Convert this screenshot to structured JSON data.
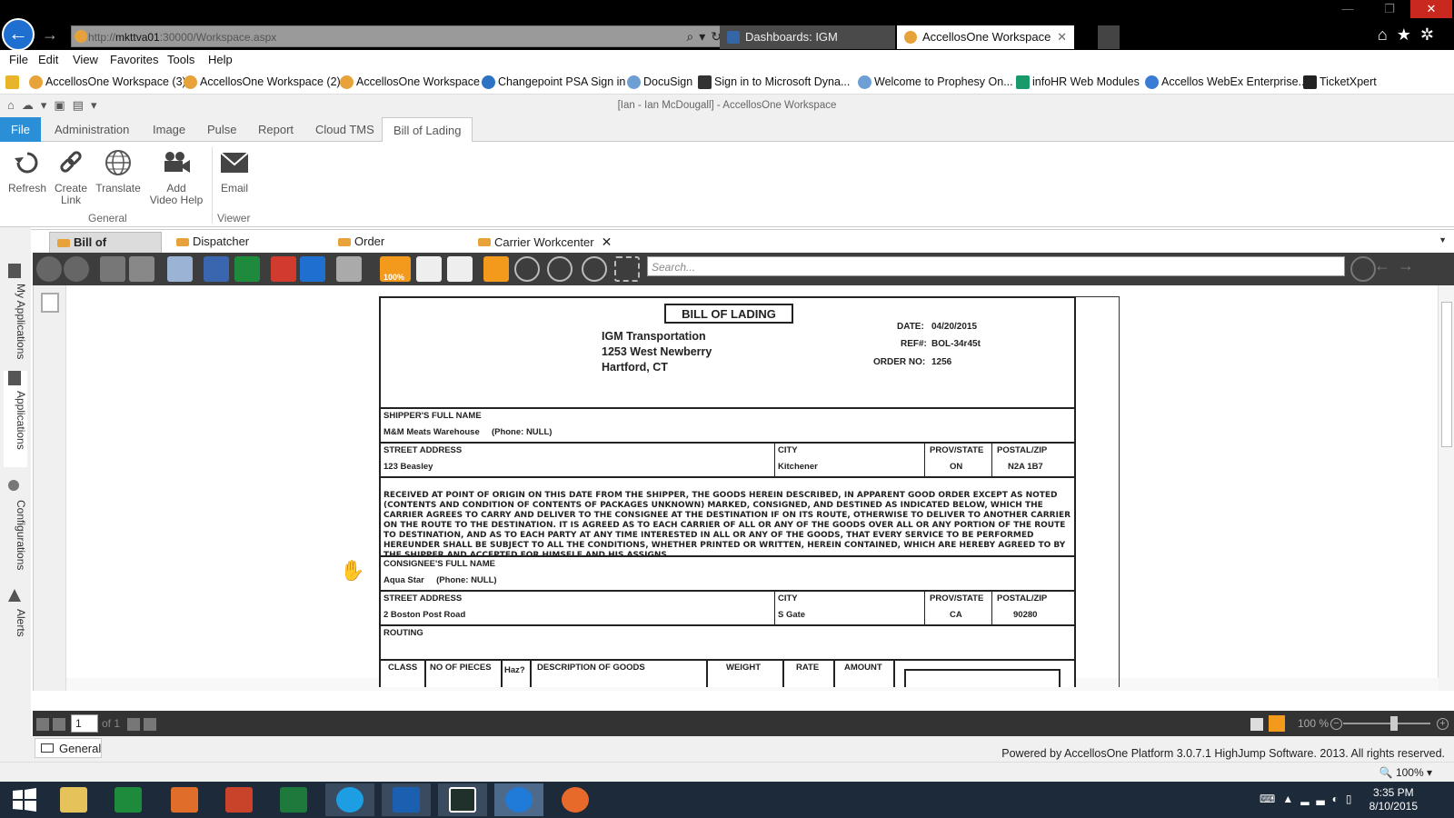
{
  "browser": {
    "url_prefix": "http://",
    "url_host": "mkttva01",
    "url_rest": ":30000/Workspace.aspx",
    "tabs": [
      {
        "label": "Dashboards: IGM Dashboard - ...",
        "active": false
      },
      {
        "label": "AccellosOne Workspace",
        "active": true,
        "close": "✕"
      }
    ],
    "menu": [
      "File",
      "Edit",
      "View",
      "Favorites",
      "Tools",
      "Help"
    ],
    "favorites": [
      "AccellosOne Workspace (3)",
      "AccellosOne Workspace (2)",
      "AccellosOne Workspace",
      "Changepoint PSA Sign in",
      "DocuSign",
      "Sign in to Microsoft Dyna...",
      "Welcome to Prophesy On...",
      "infoHR Web Modules",
      "Accellos WebEx Enterprise...",
      "TicketXpert"
    ],
    "window_title": "[Ian - Ian McDougall] - AccellosOne Workspace"
  },
  "ribbon": {
    "tabs": [
      "File",
      "Administration",
      "Image",
      "Pulse",
      "Report",
      "Cloud TMS",
      "Bill of Lading"
    ],
    "buttons": [
      {
        "label1": "Refresh",
        "label2": ""
      },
      {
        "label1": "Create",
        "label2": "Link"
      },
      {
        "label1": "Translate",
        "label2": ""
      },
      {
        "label1": "Add",
        "label2": "Video Help"
      },
      {
        "label1": "Email",
        "label2": ""
      }
    ],
    "groups": [
      "General",
      "Viewer"
    ]
  },
  "leftnav": [
    "My Applications",
    "Applications",
    "Configurations",
    "Alerts"
  ],
  "doc_tabs": [
    {
      "label": "Bill of Lading",
      "active": true
    },
    {
      "label": "Dispatcher Workcenter",
      "active": false
    },
    {
      "label": "Order Workcenter",
      "active": false
    },
    {
      "label": "Carrier Workcenter",
      "active": false
    }
  ],
  "viewer": {
    "search_placeholder": "Search...",
    "zoom_badge": "100%",
    "page_current": "1",
    "page_of": "of 1",
    "zoom_level": "100 %"
  },
  "bol": {
    "title": "BILL OF LADING",
    "company_name": "IGM Transportation",
    "company_addr1": "1253 West Newberry",
    "company_addr2": "Hartford, CT",
    "date_label": "DATE:",
    "date_value": "04/20/2015",
    "ref_label": "REF#:",
    "ref_value": "BOL-34r45t",
    "order_label": "ORDER NO:",
    "order_value": "1256",
    "shipper_label": "SHIPPER'S FULL NAME",
    "shipper_name": "M&M Meats Warehouse",
    "shipper_phone": "(Phone: NULL)",
    "street_label": "STREET ADDRESS",
    "city_label": "CITY",
    "prov_label": "PROV/STATE",
    "postal_label": "POSTAL/ZIP",
    "shipper_street": "123 Beasley",
    "shipper_city": "Kitchener",
    "shipper_prov": "ON",
    "shipper_postal": "N2A 1B7",
    "terms": "RECEIVED AT POINT OF ORIGIN ON THIS DATE FROM THE SHIPPER, THE GOODS HEREIN DESCRIBED, IN APPARENT GOOD ORDER EXCEPT AS NOTED (CONTENTS AND CONDITION OF CONTENTS OF PACKAGES UNKNOWN) MARKED, CONSIGNED, AND DESTINED AS INDICATED BELOW, WHICH THE CARRIER AGREES TO CARRY AND DELIVER TO THE CONSIGNEE AT THE DESTINATION IF ON ITS ROUTE, OTHERWISE TO DELIVER TO ANOTHER CARRIER ON THE ROUTE TO THE DESTINATION. IT IS AGREED AS TO EACH CARRIER OF ALL OR ANY OF THE GOODS OVER ALL OR ANY PORTION OF THE ROUTE TO DESTINATION, AND AS TO EACH PARTY AT ANY TIME INTERESTED IN ALL OR ANY OF THE GOODS, THAT EVERY SERVICE TO BE PERFORMED HEREUNDER SHALL BE SUBJECT TO ALL THE CONDITIONS, WHETHER PRINTED OR WRITTEN, HEREIN CONTAINED, WHICH ARE HEREBY AGREED TO BY THE SHIPPER AND ACCEPTED FOR HIMSELF AND HIS ASSIGNS.",
    "consignee_label": "CONSIGNEE'S FULL NAME",
    "consignee_name": "Aqua Star",
    "consignee_phone": "(Phone: NULL)",
    "consignee_street": "2 Boston Post Road",
    "consignee_city": "S Gate",
    "consignee_prov": "CA",
    "consignee_postal": "90280",
    "routing_label": "ROUTING",
    "columns": [
      "CLASS",
      "NO OF PIECES",
      "Haz?",
      "DESCRIPTION OF GOODS",
      "WEIGHT",
      "RATE",
      "AMOUNT"
    ]
  },
  "footer": {
    "general_tab": "General",
    "powered": "Powered by AccellosOne Platform 3.0.7.1 HighJump Software. 2013. All rights reserved.",
    "ie_zoom": "100%"
  },
  "taskbar": {
    "time": "3:35 PM",
    "date": "8/10/2015"
  },
  "colors": {
    "accent": "#2b8fd8",
    "highlight": "#f39a1d",
    "viewer_toolbar": "#3d3d3d"
  }
}
